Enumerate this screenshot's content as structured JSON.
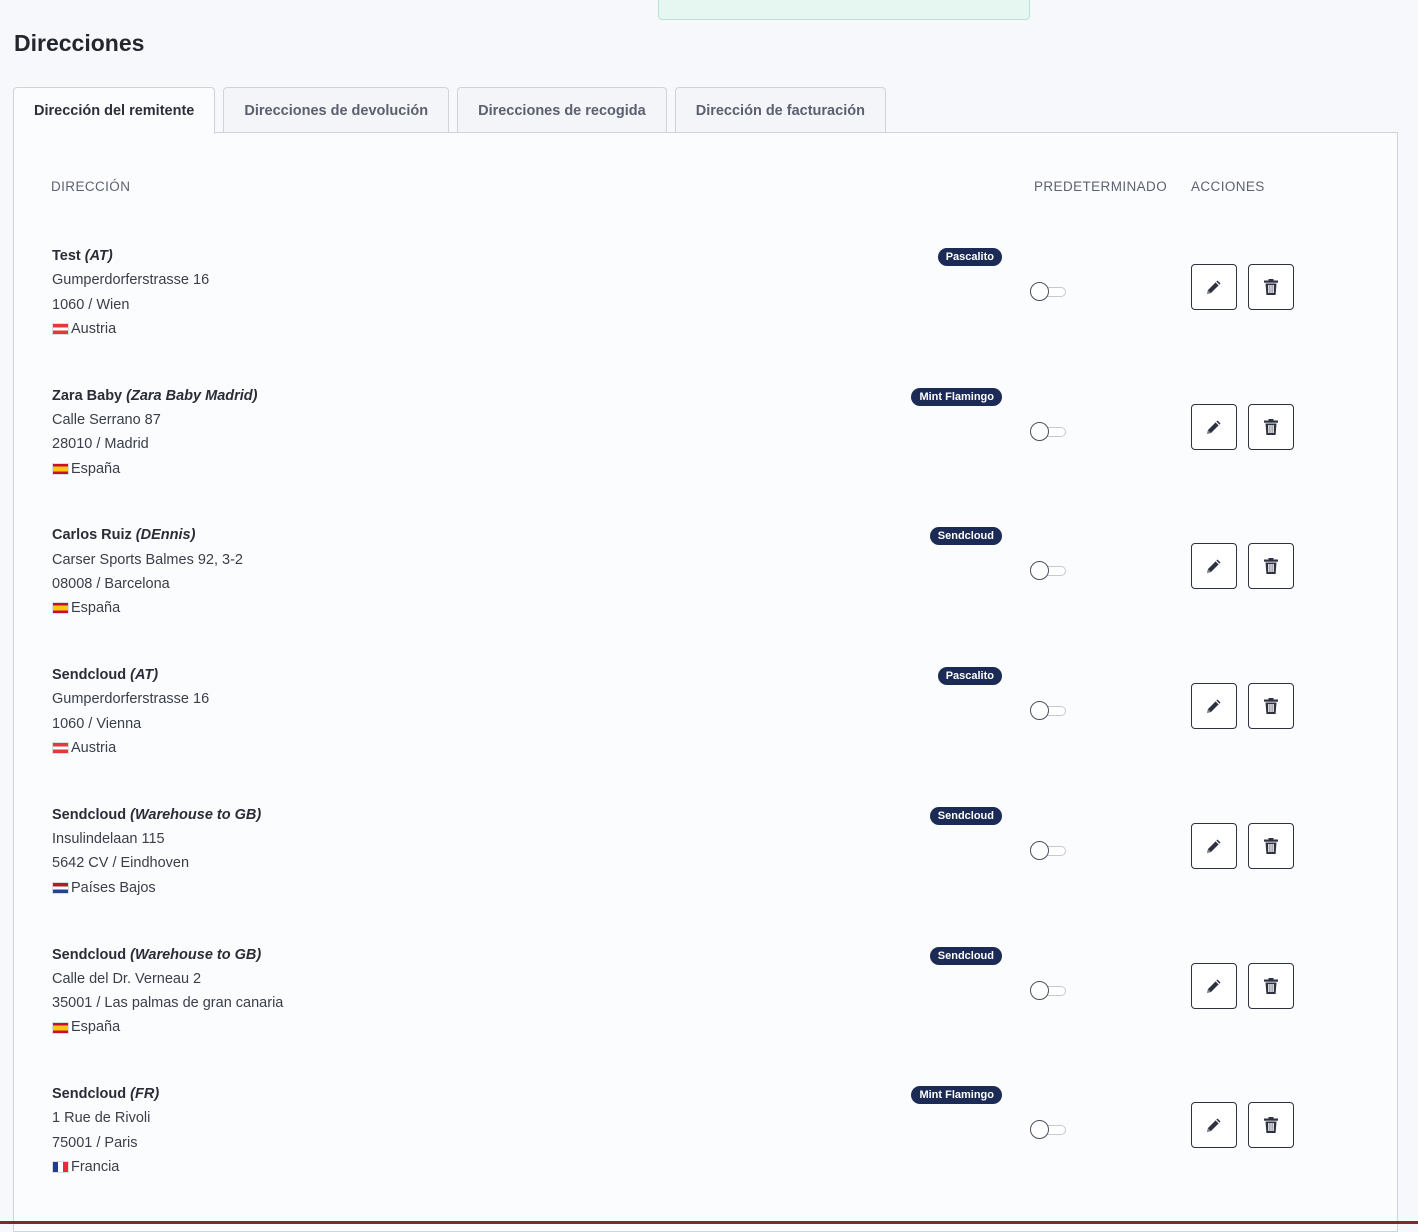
{
  "page": {
    "title": "Direcciones"
  },
  "tabs": [
    {
      "label": "Dirección del remitente",
      "active": true
    },
    {
      "label": "Direcciones de devolución",
      "active": false
    },
    {
      "label": "Direcciones de recogida",
      "active": false
    },
    {
      "label": "Dirección de facturación",
      "active": false
    }
  ],
  "table": {
    "headers": {
      "address": "DIRECCIÓN",
      "default": "PREDETERMINADO",
      "actions": "ACCIONES"
    },
    "rows": [
      {
        "name": "Test",
        "alias": "(AT)",
        "street": "Gumperdorferstrasse 16",
        "city_line": "1060 / Wien",
        "country": "Austria",
        "flag": "at",
        "carrier": "Pascalito",
        "default": false
      },
      {
        "name": "Zara Baby",
        "alias": "(Zara Baby Madrid)",
        "street": "Calle Serrano 87",
        "city_line": "28010 / Madrid",
        "country": "España",
        "flag": "es",
        "carrier": "Mint Flamingo",
        "default": false
      },
      {
        "name": "Carlos Ruiz",
        "alias": "(DEnnis)",
        "street": "Carser Sports Balmes 92, 3-2",
        "city_line": "08008 / Barcelona",
        "country": "España",
        "flag": "es",
        "carrier": "Sendcloud",
        "default": false
      },
      {
        "name": "Sendcloud",
        "alias": "(AT)",
        "street": "Gumperdorferstrasse 16",
        "city_line": "1060 / Vienna",
        "country": "Austria",
        "flag": "at",
        "carrier": "Pascalito",
        "default": false
      },
      {
        "name": "Sendcloud",
        "alias": "(Warehouse to GB)",
        "street": "Insulindelaan 115",
        "city_line": "5642 CV / Eindhoven",
        "country": "Países Bajos",
        "flag": "nl",
        "carrier": "Sendcloud",
        "default": false
      },
      {
        "name": "Sendcloud",
        "alias": "(Warehouse to GB)",
        "street": "Calle del Dr. Verneau 2",
        "city_line": "35001 / Las palmas de gran canaria",
        "country": "España",
        "flag": "es",
        "carrier": "Sendcloud",
        "default": false
      },
      {
        "name": "Sendcloud",
        "alias": "(FR)",
        "street": "1 Rue de Rivoli",
        "city_line": "75001 / Paris",
        "country": "Francia",
        "flag": "fr",
        "carrier": "Mint Flamingo",
        "default": false
      }
    ]
  },
  "icons": {
    "edit": "pencil-icon",
    "delete": "trash-icon"
  },
  "colors": {
    "badge_bg": "#1c2b55",
    "border": "#cfd3db",
    "text": "#2c2f3a"
  }
}
